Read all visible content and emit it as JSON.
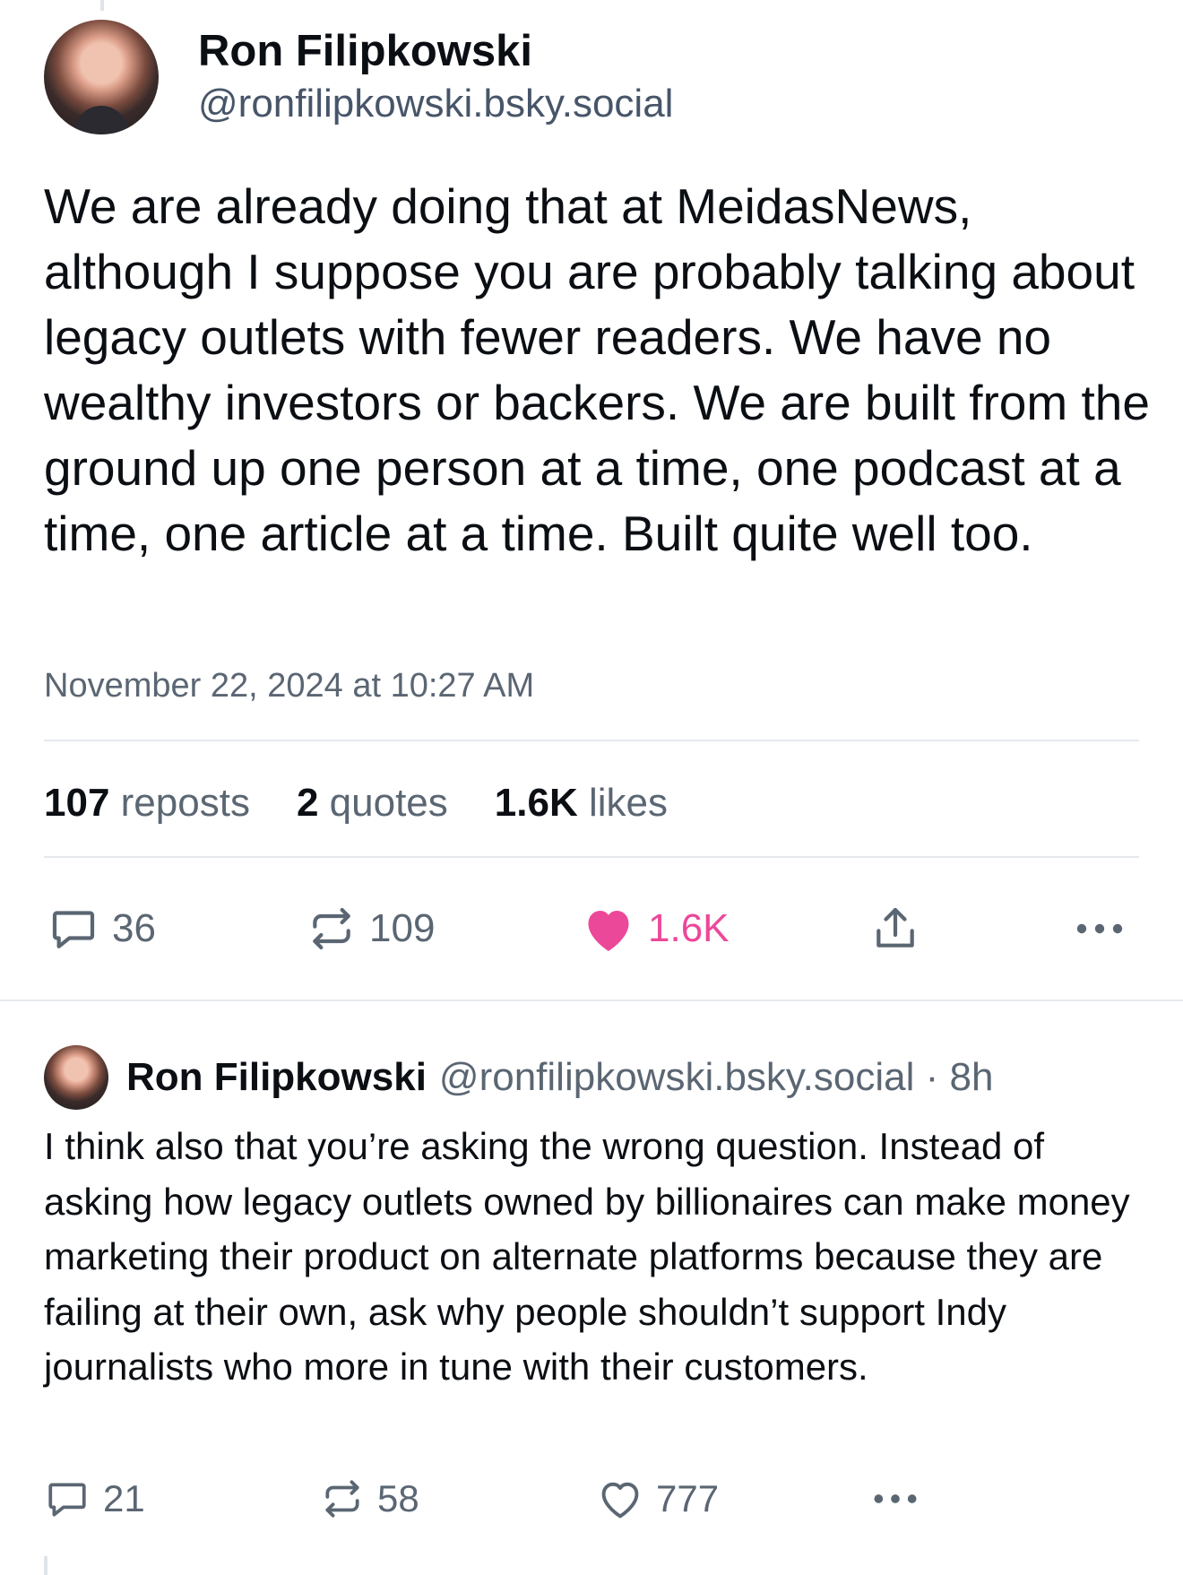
{
  "main_post": {
    "author_name": "Ron Filipkowski",
    "author_handle": "@ronfilipkowski.bsky.social",
    "text": "We are already doing that at MeidasNews, although I suppose you are probably talking about legacy outlets with fewer readers. We have no wealthy investors or backers. We are built from the ground up one person at a time, one podcast at a time, one article at a time. Built quite well too.",
    "timestamp": "November 22, 2024 at 10:27 AM",
    "stats": {
      "reposts_count": "107",
      "reposts_label": "reposts",
      "quotes_count": "2",
      "quotes_label": "quotes",
      "likes_count": "1.6K",
      "likes_label": "likes"
    },
    "actions": {
      "replies": "36",
      "reposts": "109",
      "likes": "1.6K",
      "like_state": "liked",
      "like_color": "#ec4899"
    }
  },
  "reply_post": {
    "author_name": "Ron Filipkowski",
    "author_handle_time": "@ronfilipkowski.bsky.social · 8h",
    "text": "I think also that you’re asking the wrong question. Instead of asking how legacy outlets owned by billionaires can make money marketing their product on alternate platforms because they are failing at their own, ask why people shouldn’t support Indy journalists who more in tune with their customers.",
    "actions": {
      "replies": "21",
      "reposts": "58",
      "likes": "777"
    }
  },
  "icons": [
    "reply-icon",
    "repost-icon",
    "heart-icon",
    "share-icon",
    "more-icon"
  ]
}
